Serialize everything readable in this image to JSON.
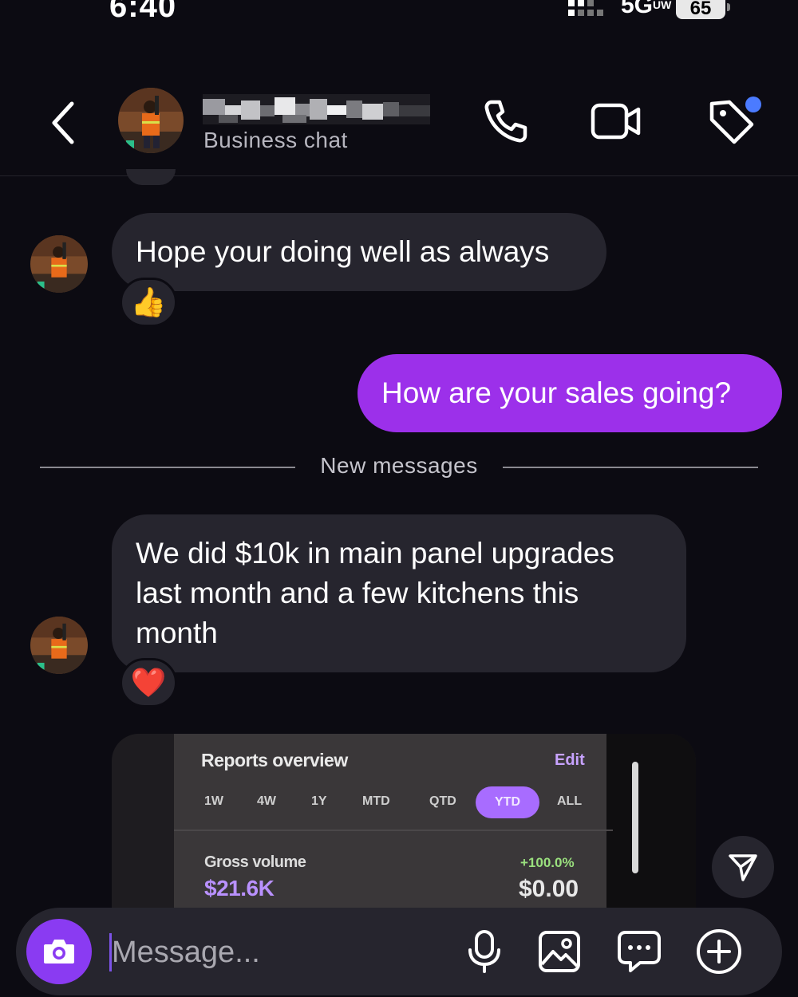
{
  "status_bar": {
    "time": "6:40",
    "network": "5G",
    "network_sup": "UW",
    "battery": "65"
  },
  "header": {
    "subtitle": "Business chat",
    "icons": [
      "back-arrow-icon",
      "phone-icon",
      "video-camera-icon",
      "tag-icon"
    ]
  },
  "messages": {
    "m1": {
      "text": "Hope your doing well as always",
      "reaction": "👍"
    },
    "m2": {
      "text": "How are your sales going?"
    },
    "divider": "New messages",
    "m3": {
      "text": "We did $10k in main panel upgrades last month and a few kitchens this month",
      "reaction": "❤️"
    }
  },
  "screenshot_card": {
    "title": "Reports overview",
    "edit": "Edit",
    "ranges": [
      "1W",
      "4W",
      "1Y",
      "MTD",
      "QTD",
      "YTD",
      "ALL"
    ],
    "active_range": "YTD",
    "metric_label": "Gross volume",
    "metric_value": "$21.6K",
    "change": "+100.0%",
    "compare_value": "$0.00"
  },
  "composer": {
    "placeholder": "Message...",
    "icons": [
      "camera-icon",
      "microphone-icon",
      "image-icon",
      "chat-bubble-icon",
      "plus-circle-icon"
    ]
  },
  "colors": {
    "accent": "#9c30ea",
    "camera": "#8a3bf2",
    "bubble_in": "#26252e",
    "background": "#0c0b12"
  }
}
